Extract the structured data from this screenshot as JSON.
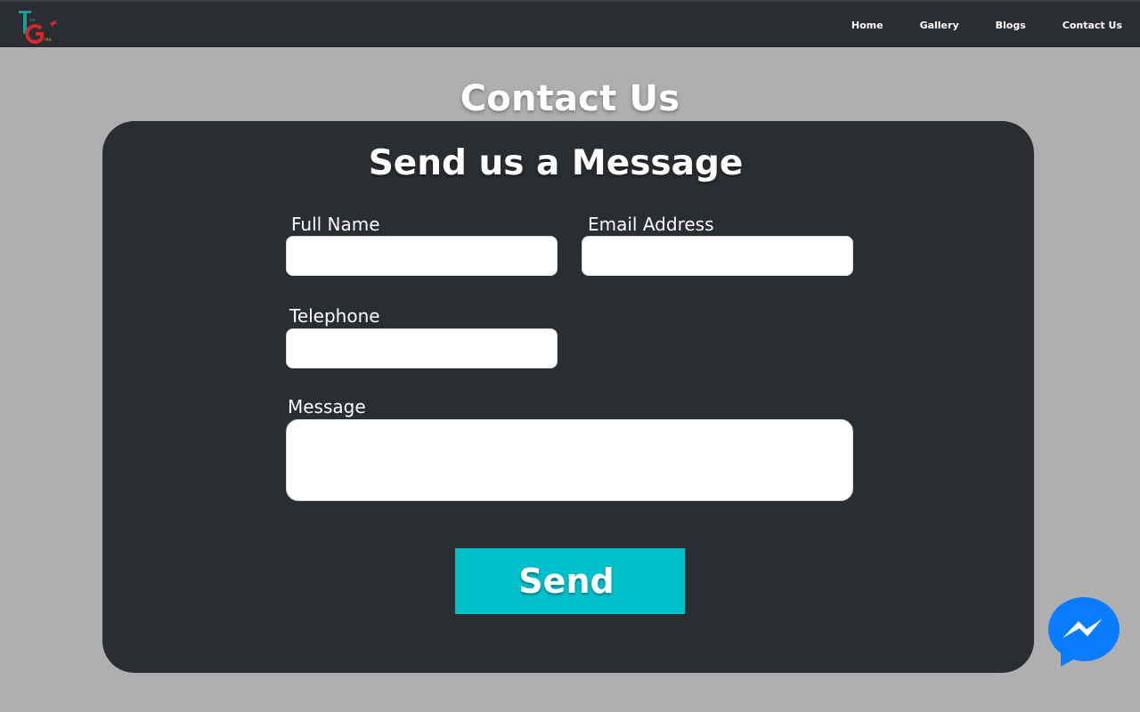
{
  "header": {
    "logo_text": "TG",
    "nav": [
      {
        "label": "Home"
      },
      {
        "label": "Gallery"
      },
      {
        "label": "Blogs"
      },
      {
        "label": "Contact Us"
      }
    ]
  },
  "page": {
    "title": "Contact Us"
  },
  "form": {
    "title": "Send us a Message",
    "full_name": {
      "label": "Full Name",
      "value": "",
      "placeholder": ""
    },
    "email": {
      "label": "Email Address",
      "value": "",
      "placeholder": ""
    },
    "telephone": {
      "label": "Telephone",
      "value": "",
      "placeholder": ""
    },
    "message": {
      "label": "Message",
      "value": "",
      "placeholder": ""
    },
    "send_label": "Send"
  },
  "chat_widget": {
    "icon": "messenger-icon"
  },
  "colors": {
    "navbar": "#2a2d31",
    "page_bg": "#afafaf",
    "card": "#2a2d31",
    "send_button": "#00c0cc",
    "messenger": "#0a7cff"
  }
}
